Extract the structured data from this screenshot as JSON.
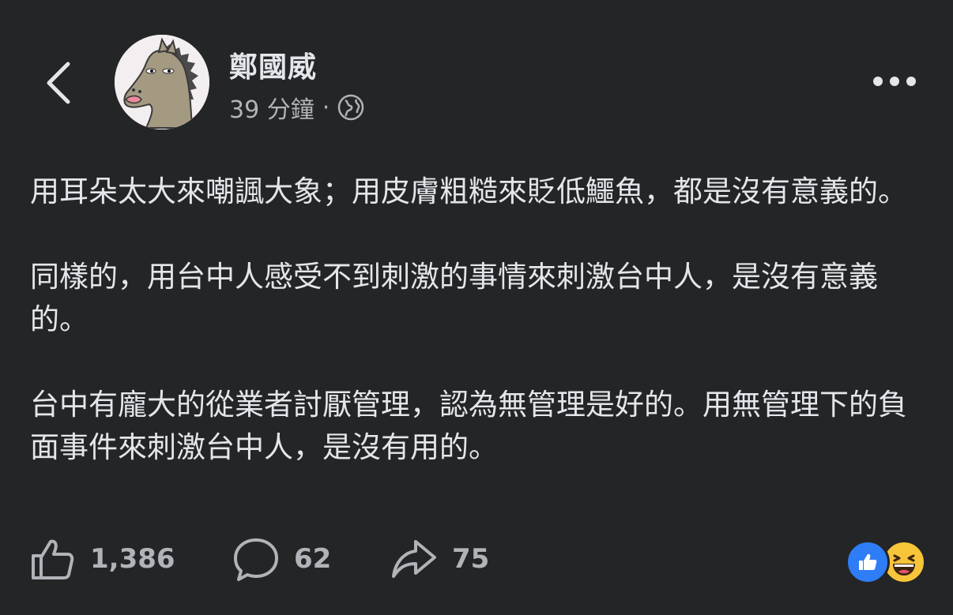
{
  "header": {
    "author_name": "鄭國威",
    "time": "39 分鐘",
    "separator": "·",
    "icons": {
      "back": "chevron-left-icon",
      "privacy": "globe-icon",
      "more": "more-horizontal-icon"
    }
  },
  "post": {
    "paragraphs": [
      "用耳朵太大來嘲諷大象；用皮膚粗糙來貶低鱷魚，都是沒有意義的。",
      "同樣的，用台中人感受不到刺激的事情來刺激台中人，是沒有意義的。",
      "台中有龐大的從業者討厭管理，認為無管理是好的。用無管理下的負面事件來刺激台中人，是沒有用的。"
    ]
  },
  "actions": {
    "like_count": "1,386",
    "comment_count": "62",
    "share_count": "75",
    "icons": {
      "like": "thumbs-up-icon",
      "comment": "comment-bubble-icon",
      "share": "share-arrow-icon"
    }
  },
  "reactions": {
    "types": [
      "like",
      "haha"
    ],
    "colors": {
      "like": "#2f7df6",
      "haha": "#f7c53a"
    }
  },
  "colors": {
    "background": "#242526",
    "text_primary": "#e4e6eb",
    "text_secondary": "#b0b3b8"
  }
}
